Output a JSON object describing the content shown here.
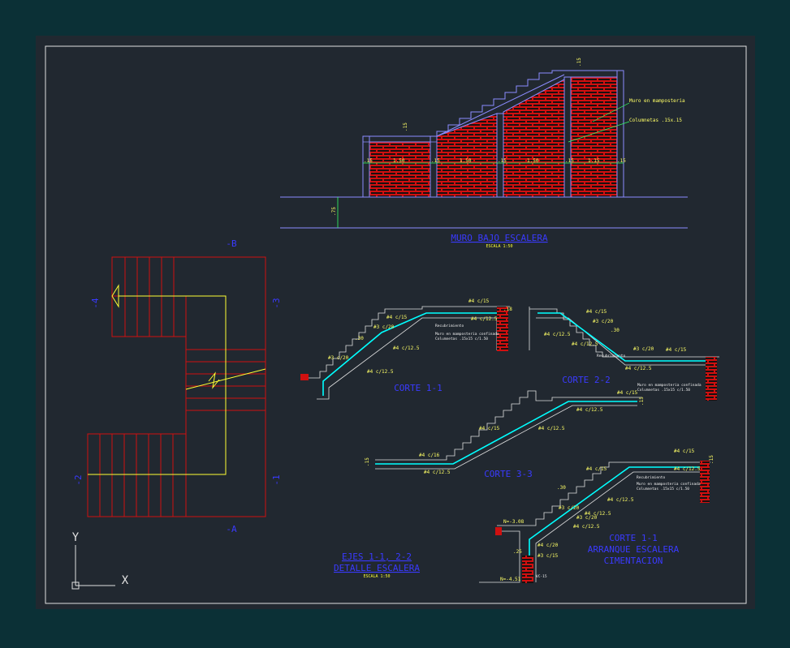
{
  "colors": {
    "background": "#0b3036",
    "drawing_area": "#212830",
    "frame": "#e0e0e0",
    "brick": "#d01010",
    "rebar": "#00ffff",
    "annotation": "#ffff55",
    "dimension": "#33ff66",
    "outline": "#8c8cff",
    "title": "#3a3aff"
  },
  "wall_elevation": {
    "title": "MURO BAJO ESCALERA",
    "scale": "ESCALA 1:50",
    "dimensions": [
      ".15",
      "1.50",
      ".15",
      "1.50",
      ".15",
      "1.50",
      ".15",
      "1.15",
      ".15"
    ],
    "top_dims": [
      ".15",
      ".15"
    ],
    "height_dim": ".75",
    "callout_masonry": "Muro en mamposteria",
    "callout_columns": "Columnetas .15x.15"
  },
  "plan": {
    "axis_labels": [
      "-B",
      "-A",
      "-4",
      "-3",
      "-2",
      "-1"
    ],
    "title_line1": "EJES 1-1, 2-2",
    "title_line2": "DETALLE ESCALERA",
    "scale": "ESCALA 1:50"
  },
  "section_1": {
    "title": "CORTE 1-1",
    "labels": [
      "#4 c/15",
      "#4 c/15",
      "#4 c/12.5",
      "#3 c/20",
      "#4 c/12.5",
      "#3 c/20",
      "#4 c/12.5",
      ".30",
      ".18"
    ],
    "callout_a": "Recubrimiento",
    "callout_b": "Muro en mamposteria confinada",
    "callout_c": "Columnetas .15x15 c/1.50"
  },
  "section_2": {
    "title": "CORTE 2-2",
    "labels": [
      "#4 c/15",
      "#3 c/20",
      "#4 c/12.5",
      ".30",
      "#4 c/12.5",
      "#3 c/20",
      "#4 c/15",
      "#4 c/12.5"
    ],
    "callout_a": "Recubrimiento",
    "callout_b": "Muro en mamposteria confinada",
    "callout_c": "Columnetas .15x15 c/1.50"
  },
  "section_3": {
    "title": "CORTE 3-3",
    "labels": [
      "#4 c/16",
      "#4 c/12.5",
      "#4 c/15",
      "#4 c/12.5",
      "#4 c/12.5",
      "#4 c/15",
      ".15",
      ".15"
    ]
  },
  "section_4": {
    "title_line1": "CORTE 1-1",
    "title_line2": "ARRANQUE ESCALERA",
    "title_line3": "CIMENTACION",
    "labels": [
      "#4 c/15",
      "#4 c/15",
      "#4 c/12.5",
      ".30",
      "#3 c/20",
      "#4 c/12.5",
      "#3 c/20",
      "#4 c/12.5",
      "#4 c/20",
      "#3 c/15",
      "#4 c/12.5",
      ".15",
      ".25"
    ],
    "level_top": "N=-3.08",
    "level_bottom": "N=-4.51",
    "beam": "VC-15",
    "callout_a": "Recubrimiento",
    "callout_b": "Muro en mamposteria confinada",
    "callout_c": "Columnetas .15x15 c/1.50"
  },
  "ucs": {
    "x": "X",
    "y": "Y"
  }
}
